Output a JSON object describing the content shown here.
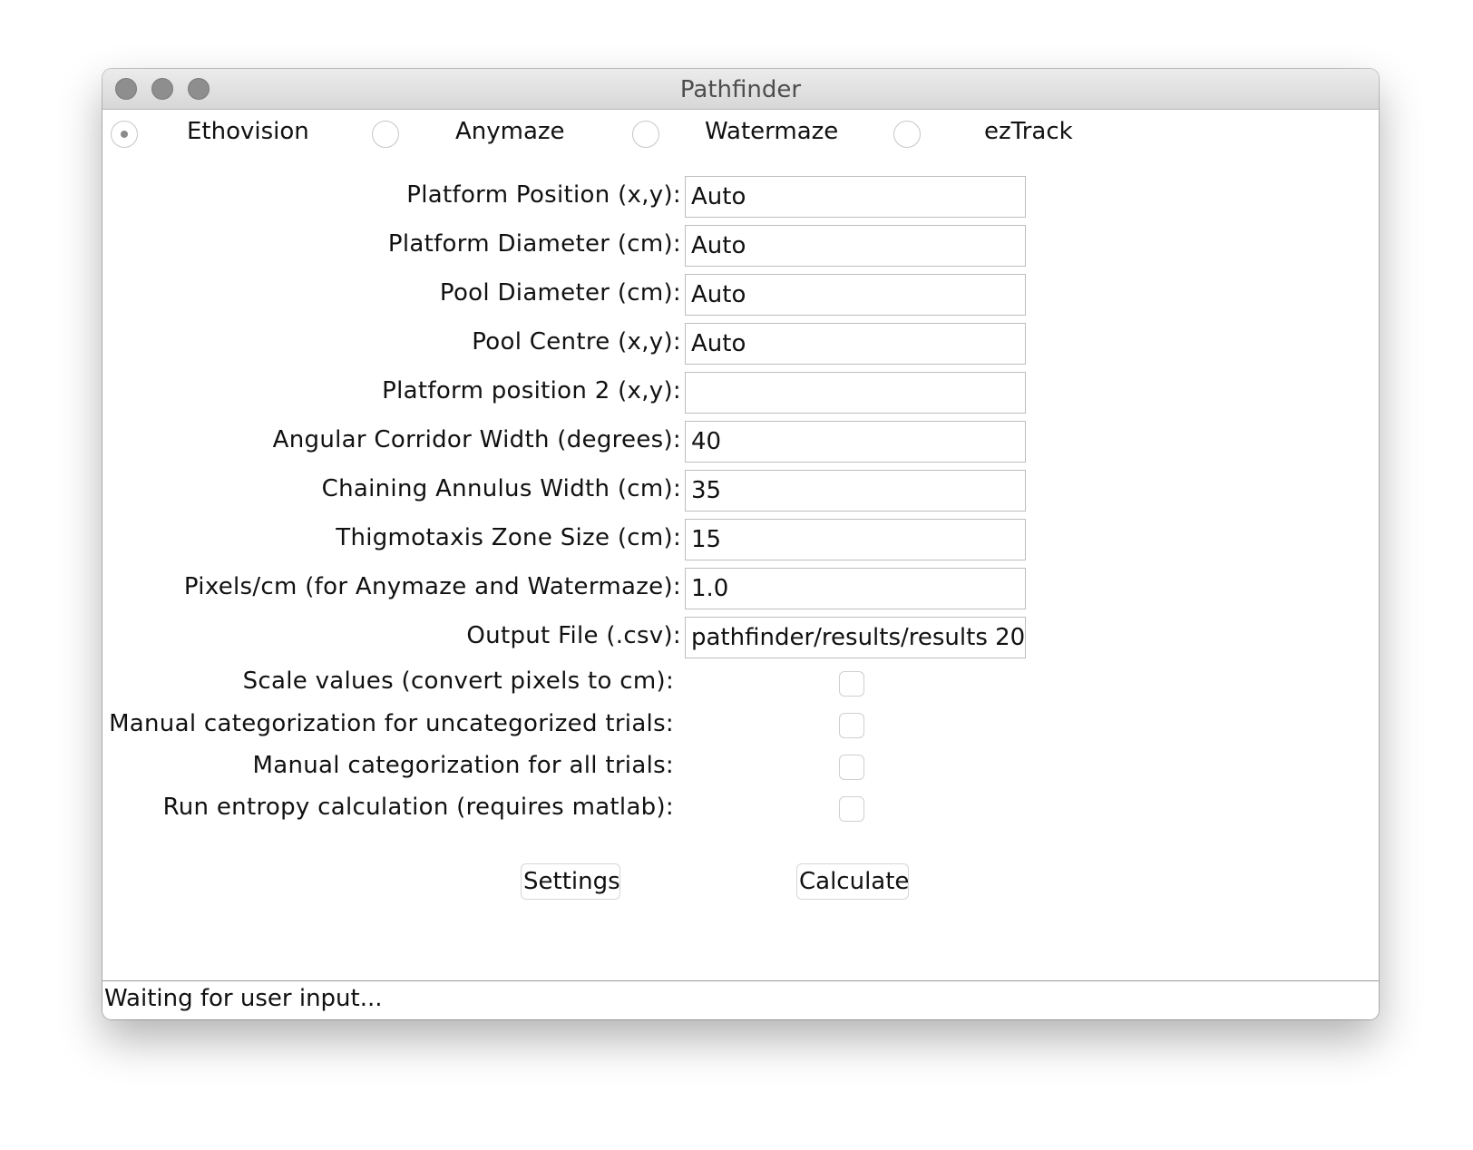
{
  "window": {
    "title": "Pathfinder"
  },
  "sources": [
    {
      "label": "Ethovision",
      "selected": true
    },
    {
      "label": "Anymaze",
      "selected": false
    },
    {
      "label": "Watermaze",
      "selected": false
    },
    {
      "label": "ezTrack",
      "selected": false
    }
  ],
  "fields": [
    {
      "label": "Platform Position (x,y):",
      "value": "Auto"
    },
    {
      "label": "Platform Diameter (cm):",
      "value": "Auto"
    },
    {
      "label": "Pool Diameter (cm):",
      "value": "Auto"
    },
    {
      "label": "Pool Centre (x,y):",
      "value": "Auto"
    },
    {
      "label": "Platform position 2 (x,y):",
      "value": ""
    },
    {
      "label": "Angular Corridor Width (degrees):",
      "value": "40"
    },
    {
      "label": "Chaining Annulus Width (cm):",
      "value": "35"
    },
    {
      "label": "Thigmotaxis Zone Size (cm):",
      "value": "15"
    },
    {
      "label": "Pixels/cm (for Anymaze and Watermaze):",
      "value": "1.0"
    },
    {
      "label": "Output File (.csv):",
      "value": "pathfinder/results/results 20"
    }
  ],
  "options": [
    {
      "label": "Scale values (convert pixels to cm):",
      "checked": false
    },
    {
      "label": "Manual categorization for uncategorized trials:",
      "checked": false
    },
    {
      "label": "Manual categorization for all trials:",
      "checked": false
    },
    {
      "label": "Run entropy calculation (requires matlab):",
      "checked": false
    }
  ],
  "buttons": {
    "settings": "Settings",
    "calculate": "Calculate"
  },
  "status": {
    "text": "Waiting for user input..."
  }
}
